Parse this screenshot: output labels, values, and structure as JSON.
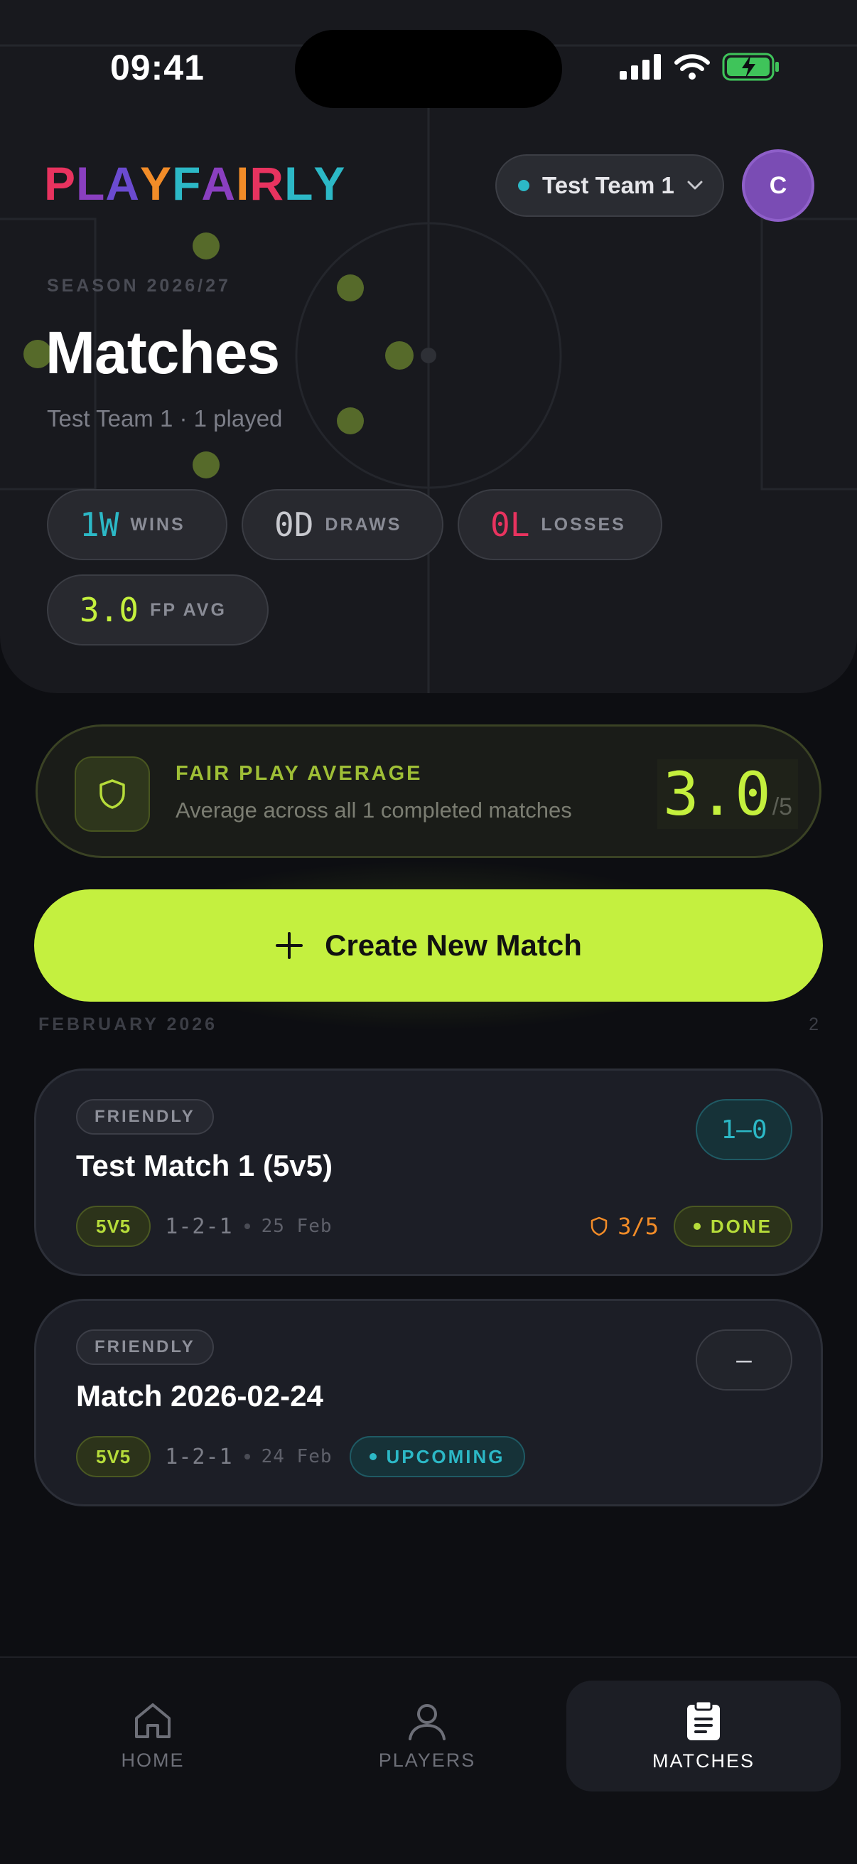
{
  "status_bar": {
    "time": "09:41"
  },
  "header": {
    "logo_letters": [
      {
        "char": "P",
        "color": "#e8335f"
      },
      {
        "char": "L",
        "color": "#8a3fc0"
      },
      {
        "char": "A",
        "color": "#6b4bd0"
      },
      {
        "char": "Y",
        "color": "#f28c28"
      },
      {
        "char": "F",
        "color": "#2cb8c6"
      },
      {
        "char": "A",
        "color": "#8a3fc0"
      },
      {
        "char": "I",
        "color": "#f28c28"
      },
      {
        "char": "R",
        "color": "#e8335f"
      },
      {
        "char": "L",
        "color": "#2cb8c6"
      },
      {
        "char": "Y",
        "color": "#2cb8c6"
      }
    ],
    "team_selector": "Test Team 1",
    "avatar_initial": "C"
  },
  "hero": {
    "season": "SEASON 2026/27",
    "title": "Matches",
    "subtitle": "Test Team 1 · 1 played",
    "stats": [
      {
        "value": "1W",
        "label": "WINS",
        "color": "#2cb8c6"
      },
      {
        "value": "0D",
        "label": "DRAWS",
        "color": "#c8c9cf"
      },
      {
        "value": "0L",
        "label": "LOSSES",
        "color": "#e8335f"
      },
      {
        "value": "3.0",
        "label": "FP AVG",
        "color": "#c4f03d"
      }
    ]
  },
  "fair_play": {
    "title": "FAIR PLAY AVERAGE",
    "description": "Average across all 1 completed matches",
    "score": "3.0",
    "out_of": "/5"
  },
  "create_button": {
    "label": "Create New Match"
  },
  "month_group": {
    "label": "FEBRUARY 2026",
    "count": "2"
  },
  "matches": [
    {
      "type": "FRIENDLY",
      "title": "Test Match 1 (5v5)",
      "format": "5V5",
      "formation": "1-2-1",
      "date": "25 Feb",
      "score": "1–0",
      "fair_play": "3/5",
      "status": "DONE"
    },
    {
      "type": "FRIENDLY",
      "title": "Match 2026-02-24",
      "format": "5V5",
      "formation": "1-2-1",
      "date": "24 Feb",
      "score": "–",
      "status": "UPCOMING"
    }
  ],
  "tabs": [
    {
      "label": "HOME",
      "icon": "home-icon"
    },
    {
      "label": "PLAYERS",
      "icon": "user-icon"
    },
    {
      "label": "MATCHES",
      "icon": "clipboard-icon",
      "active": true
    }
  ]
}
